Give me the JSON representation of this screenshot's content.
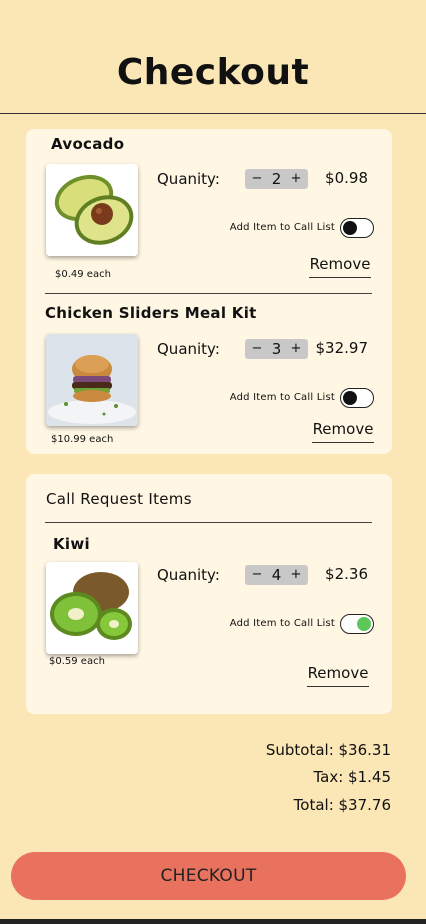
{
  "page": {
    "title": "Checkout"
  },
  "cart": {
    "items": [
      {
        "name": "Avocado",
        "quantity_label": "Quanity:",
        "quantity": "2",
        "decrement": "−",
        "increment": "+",
        "line_total": "$0.98",
        "call_list_label": "Add Item to Call List",
        "call_list_on": false,
        "remove_label": "Remove",
        "unit_price": "$0.49  each",
        "image_icon": "avocado-image"
      },
      {
        "name": "Chicken Sliders Meal Kit",
        "quantity_label": "Quanity:",
        "quantity": "3",
        "decrement": "−",
        "increment": "+",
        "line_total": "$32.97",
        "call_list_label": "Add Item to Call List",
        "call_list_on": false,
        "remove_label": "Remove",
        "unit_price": "$10.99  each",
        "image_icon": "chicken-slider-image"
      }
    ]
  },
  "call_requests": {
    "title": "Call Request Items",
    "items": [
      {
        "name": "Kiwi",
        "quantity_label": "Quanity:",
        "quantity": "4",
        "decrement": "−",
        "increment": "+",
        "line_total": "$2.36",
        "call_list_label": "Add Item to Call List",
        "call_list_on": true,
        "remove_label": "Remove",
        "unit_price": "$0.59  each",
        "image_icon": "kiwi-image"
      }
    ]
  },
  "totals": {
    "subtotal": "Subtotal:  $36.31",
    "tax": "Tax:  $1.45",
    "total": "Total:  $37.76"
  },
  "checkout_button": "CHECKOUT",
  "colors": {
    "background": "#fbe6b5",
    "card": "#fff7e4",
    "checkout_button": "#e8725e",
    "toggle_on": "#5cc85a"
  }
}
